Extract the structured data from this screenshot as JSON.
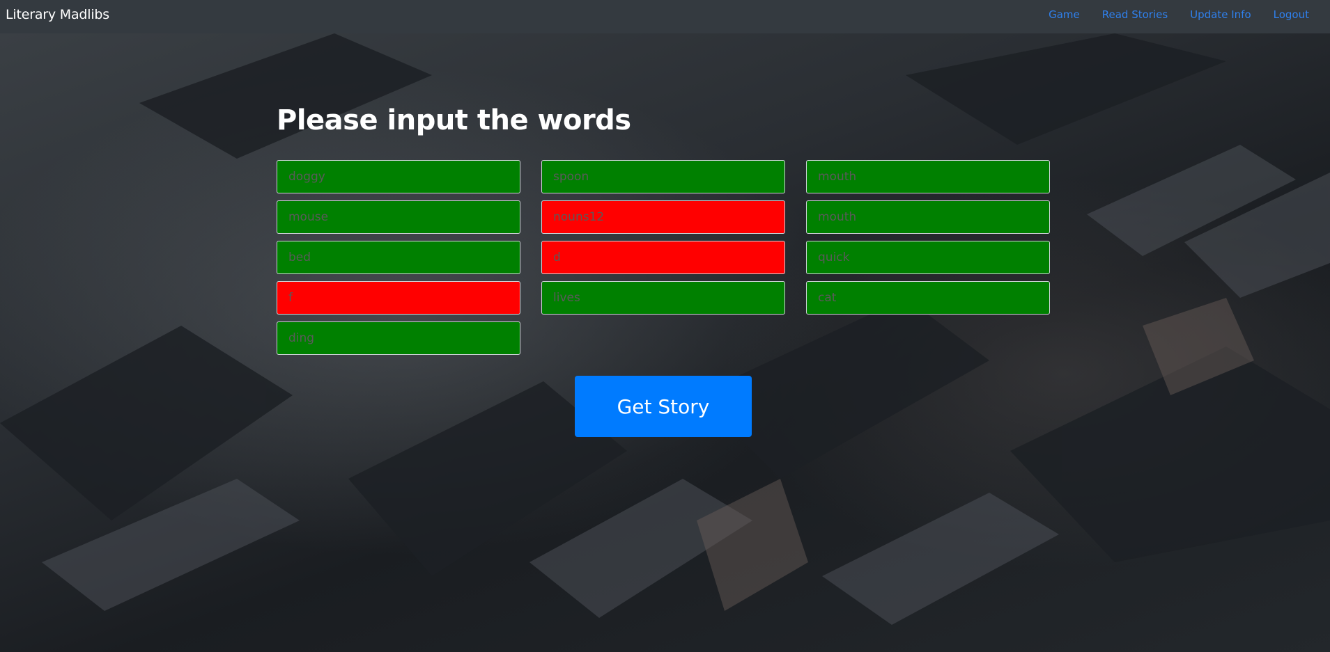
{
  "navbar": {
    "brand": "Literary Madlibs",
    "links": [
      "Game",
      "Read Stories",
      "Update Info",
      "Logout"
    ]
  },
  "main": {
    "title": "Please input the words",
    "inputs": [
      {
        "value": "doggy",
        "status": "valid"
      },
      {
        "value": "spoon",
        "status": "valid"
      },
      {
        "value": "mouth",
        "status": "valid"
      },
      {
        "value": "mouse",
        "status": "valid"
      },
      {
        "value": "nouns12",
        "status": "invalid"
      },
      {
        "value": "mouth",
        "status": "valid"
      },
      {
        "value": "bed",
        "status": "valid"
      },
      {
        "value": "d",
        "status": "invalid"
      },
      {
        "value": "quick",
        "status": "valid"
      },
      {
        "value": "f",
        "status": "invalid"
      },
      {
        "value": "lives",
        "status": "valid"
      },
      {
        "value": "cat",
        "status": "valid"
      },
      {
        "value": "ding",
        "status": "valid"
      }
    ],
    "submit_label": "Get Story"
  },
  "colors": {
    "navbar_bg": "#343a40",
    "link": "#007bff",
    "valid": "#008000",
    "invalid": "#ff0000",
    "button": "#007bff"
  }
}
